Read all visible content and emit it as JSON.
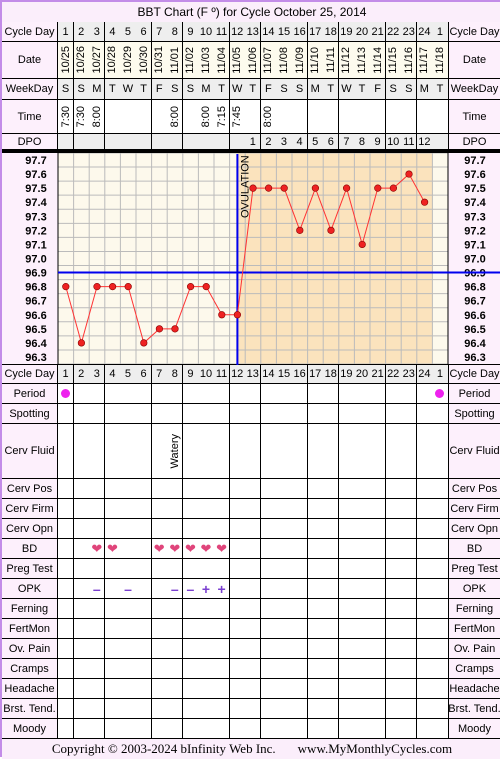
{
  "title": "BBT Chart (F º) for Cycle October 25, 2014",
  "row_labels": {
    "cycle_day": "Cycle Day",
    "date": "Date",
    "weekday": "WeekDay",
    "time": "Time",
    "dpo": "DPO",
    "period": "Period",
    "spotting": "Spotting",
    "cerv_fluid": "Cerv Fluid",
    "cerv_pos": "Cerv Pos",
    "cerv_firm": "Cerv Firm",
    "cerv_opn": "Cerv Opn",
    "bd": "BD",
    "preg_test": "Preg Test",
    "opk": "OPK",
    "ferning": "Ferning",
    "fertmon": "FertMon",
    "ov_pain": "Ov. Pain",
    "cramps": "Cramps",
    "headache": "Headache",
    "brst_tend": "Brst. Tend.",
    "moody": "Moody"
  },
  "cycle_days": [
    "1",
    "2",
    "3",
    "4",
    "5",
    "6",
    "7",
    "8",
    "9",
    "10",
    "11",
    "12",
    "13",
    "14",
    "15",
    "16",
    "17",
    "18",
    "19",
    "20",
    "21",
    "22",
    "23",
    "24",
    "1"
  ],
  "dates": [
    "10/25",
    "10/26",
    "10/27",
    "10/28",
    "10/29",
    "10/30",
    "10/31",
    "11/01",
    "11/02",
    "11/03",
    "11/04",
    "11/05",
    "11/06",
    "11/07",
    "11/08",
    "11/09",
    "11/10",
    "11/11",
    "11/12",
    "11/13",
    "11/14",
    "11/15",
    "11/16",
    "11/17",
    "11/18"
  ],
  "weekdays": [
    "S",
    "S",
    "M",
    "T",
    "W",
    "T",
    "F",
    "S",
    "S",
    "M",
    "T",
    "W",
    "T",
    "F",
    "S",
    "S",
    "M",
    "T",
    "W",
    "T",
    "F",
    "S",
    "S",
    "M",
    "T"
  ],
  "times": [
    "7:30",
    "7:30",
    "8:00",
    "",
    "",
    "",
    "",
    "8:00",
    "",
    "8:00",
    "7:15",
    "7:45",
    "",
    "8:00",
    "",
    "",
    "",
    "",
    "",
    "",
    "",
    "",
    "",
    "",
    ""
  ],
  "dpo": [
    "",
    "",
    "",
    "",
    "",
    "",
    "",
    "",
    "",
    "",
    "",
    "",
    "1",
    "2",
    "3",
    "4",
    "5",
    "6",
    "7",
    "8",
    "9",
    "10",
    "11",
    "12",
    ""
  ],
  "observations": {
    "period": [
      "dot",
      "",
      "",
      "",
      "",
      "",
      "",
      "",
      "",
      "",
      "",
      "",
      "",
      "",
      "",
      "",
      "",
      "",
      "",
      "",
      "",
      "",
      "",
      "",
      "dot"
    ],
    "cerv_fluid": [
      "",
      "",
      "",
      "",
      "",
      "",
      "",
      "Watery",
      "",
      "",
      "",
      "",
      "",
      "",
      "",
      "",
      "",
      "",
      "",
      "",
      "",
      "",
      "",
      "",
      ""
    ],
    "bd": [
      "",
      "",
      "heart",
      "heart",
      "",
      "",
      "heart",
      "heart",
      "heart",
      "heart",
      "heart",
      "",
      "",
      "",
      "",
      "",
      "",
      "",
      "",
      "",
      "",
      "",
      "",
      "",
      ""
    ],
    "opk": [
      "",
      "",
      "–",
      "",
      "–",
      "",
      "",
      "–",
      "–",
      "+",
      "+",
      "",
      "",
      "",
      "",
      "",
      "",
      "",
      "",
      "",
      "",
      "",
      "",
      "",
      ""
    ]
  },
  "chart_data": {
    "type": "line",
    "x": [
      1,
      2,
      3,
      4,
      5,
      6,
      7,
      8,
      9,
      10,
      11,
      12,
      13,
      14,
      15,
      16,
      17,
      18,
      19,
      20,
      21,
      22,
      23,
      24
    ],
    "values": [
      96.8,
      96.4,
      96.8,
      96.8,
      96.8,
      96.4,
      96.5,
      96.5,
      96.8,
      96.8,
      96.6,
      96.6,
      97.5,
      97.5,
      97.5,
      97.2,
      97.5,
      97.2,
      97.5,
      97.1,
      97.5,
      97.5,
      97.6,
      97.4
    ],
    "ylim": [
      96.3,
      97.7
    ],
    "y_ticks": [
      "97.7",
      "97.6",
      "97.5",
      "97.4",
      "97.3",
      "97.2",
      "97.1",
      "97.0",
      "96.9",
      "96.8",
      "96.7",
      "96.6",
      "96.5",
      "96.4",
      "96.3"
    ],
    "coverline": 96.9,
    "ovulation_day": 12,
    "ovulation_label": "OVULATION",
    "grid": true,
    "colors": {
      "line": "#ff3333",
      "point": "#ee2222",
      "coverline": "#0000ee",
      "ovulation": "#0000ee",
      "pre_ov_bg": "#fdf9ec",
      "post_ov_bg": "#fbe3bd"
    }
  },
  "footer": {
    "copyright": "Copyright © 2003-2024 bInfinity Web Inc.",
    "site": "www.MyMonthlyCycles.com"
  }
}
